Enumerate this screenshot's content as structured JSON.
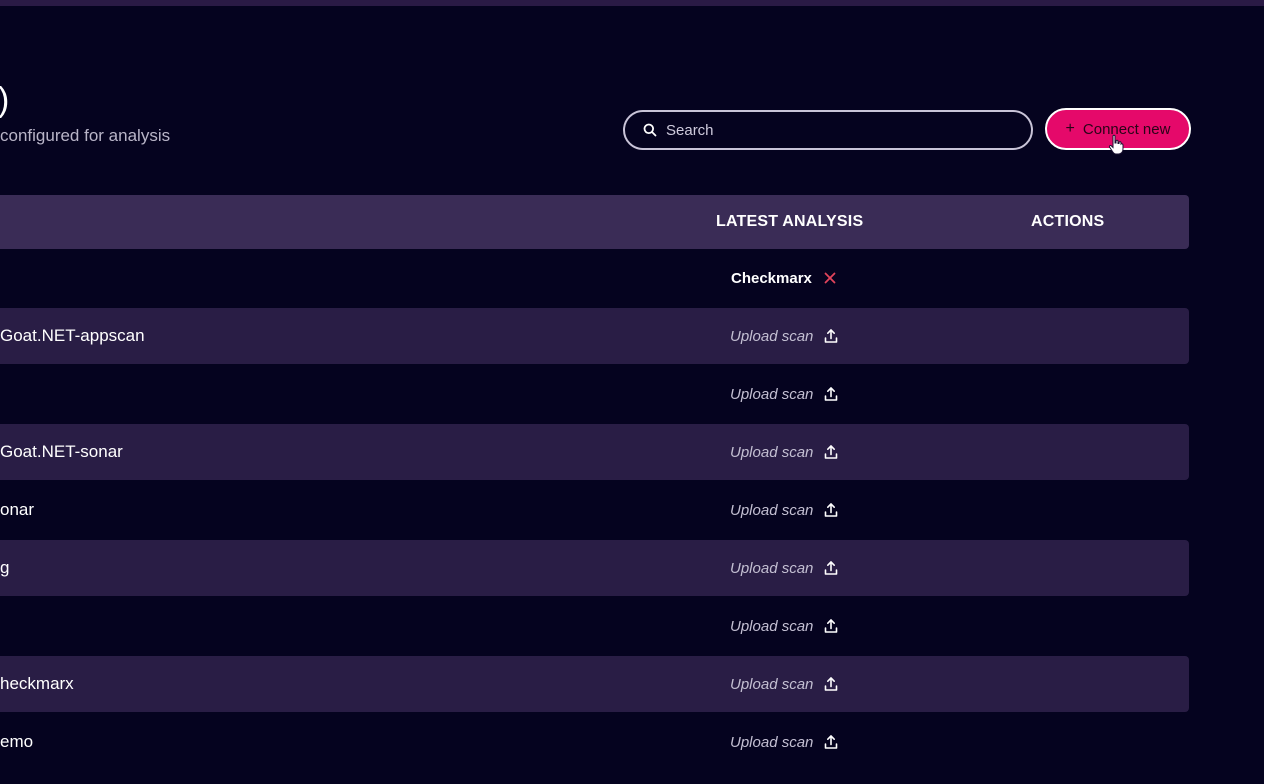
{
  "header": {
    "title": ")",
    "subtitle": "configured for analysis"
  },
  "search": {
    "placeholder": "Search",
    "icon": "search-icon"
  },
  "connect_button": {
    "label": "Connect new",
    "icon": "plus-icon",
    "background": "#e5096a"
  },
  "table": {
    "columns": {
      "latest_analysis": "LATEST ANALYSIS",
      "actions": "ACTIONS"
    },
    "rows": [
      {
        "name": "",
        "analysis": "Checkmarx",
        "analysis_icon": "close-icon",
        "kind": "tool"
      },
      {
        "name": "Goat.NET-appscan",
        "analysis": "Upload scan",
        "analysis_icon": "upload-icon",
        "kind": "upload"
      },
      {
        "name": "",
        "analysis": "Upload scan",
        "analysis_icon": "upload-icon",
        "kind": "upload"
      },
      {
        "name": "Goat.NET-sonar",
        "analysis": "Upload scan",
        "analysis_icon": "upload-icon",
        "kind": "upload"
      },
      {
        "name": "onar",
        "analysis": "Upload scan",
        "analysis_icon": "upload-icon",
        "kind": "upload"
      },
      {
        "name": "g",
        "analysis": "Upload scan",
        "analysis_icon": "upload-icon",
        "kind": "upload"
      },
      {
        "name": "",
        "analysis": "Upload scan",
        "analysis_icon": "upload-icon",
        "kind": "upload"
      },
      {
        "name": "heckmarx",
        "analysis": "Upload scan",
        "analysis_icon": "upload-icon",
        "kind": "upload"
      },
      {
        "name": "emo",
        "analysis": "Upload scan",
        "analysis_icon": "upload-icon",
        "kind": "upload"
      }
    ]
  },
  "colors": {
    "background": "#05031f",
    "row_alt": "#291d45",
    "header_bg": "#3a2c56",
    "error": "#e2445c"
  }
}
